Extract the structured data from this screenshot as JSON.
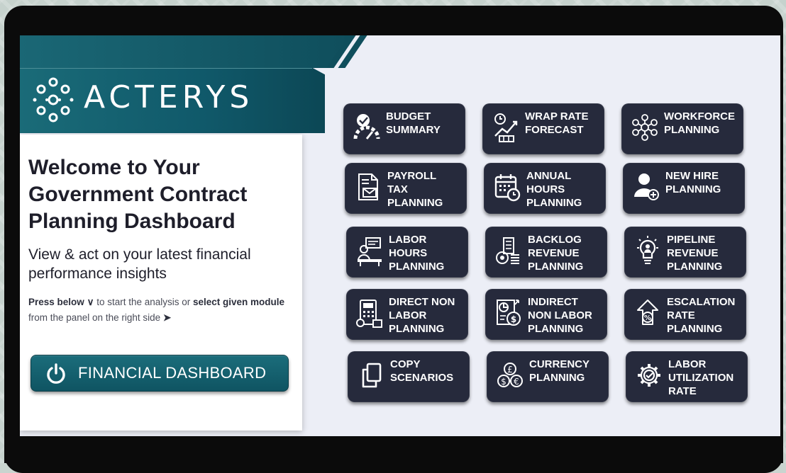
{
  "brand": {
    "name": "ACTERYS"
  },
  "welcome": {
    "title": "Welcome to Your Government Contract Planning Dashboard",
    "subtitle": "View & act on your latest financial performance insights",
    "instructions": {
      "press_below": "Press below",
      "arrow_down": "∨",
      "mid_text": " to start the analysis or ",
      "select_module": "select given module",
      "end_text": " from the panel on the right side ",
      "arrow_right": "➤"
    }
  },
  "financial_button": {
    "label": "FINANCIAL DASHBOARD",
    "icon": "power-icon"
  },
  "modules": [
    {
      "label": "BUDGET\nSUMMARY",
      "icon": "speedometer-icon"
    },
    {
      "label": "WRAP RATE\nFORECAST",
      "icon": "rate-forecast-icon"
    },
    {
      "label": "WORKFORCE\nPLANNING",
      "icon": "workforce-network-icon"
    },
    {
      "label": "PAYROLL\nTAX\nPLANNING",
      "icon": "payroll-document-icon"
    },
    {
      "label": "ANNUAL\nHOURS\nPLANNING",
      "icon": "calendar-clock-icon"
    },
    {
      "label": "NEW HIRE\nPLANNING",
      "icon": "add-user-icon"
    },
    {
      "label": "LABOR\nHOURS\nPLANNING",
      "icon": "worker-desk-icon"
    },
    {
      "label": "BACKLOG\nREVENUE\nPLANNING",
      "icon": "coins-stack-icon"
    },
    {
      "label": "PIPELINE\nREVENUE\nPLANNING",
      "icon": "lightbulb-icon"
    },
    {
      "label": "DIRECT NON\nLABOR\nPLANNING",
      "icon": "calculator-icon"
    },
    {
      "label": "INDIRECT\nNON LABOR\nPLANNING",
      "icon": "report-dollar-icon"
    },
    {
      "label": "ESCALATION\nRATE\nPLANNING",
      "icon": "percent-up-icon"
    },
    {
      "label": "COPY\nSCENARIOS",
      "icon": "copy-icon"
    },
    {
      "label": "CURRENCY\nPLANNING",
      "icon": "currency-icon"
    },
    {
      "label": "LABOR\nUTILIZATION\nRATE",
      "icon": "gear-check-icon"
    }
  ],
  "colors": {
    "brand_teal": "#10596a",
    "tile": "#262a3c",
    "screen_bg": "#eceef6"
  }
}
